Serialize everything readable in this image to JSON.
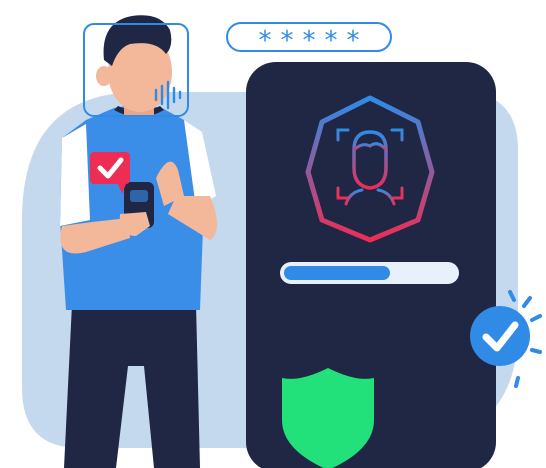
{
  "password_field": {
    "mask": "*****"
  },
  "verification": {
    "progress": 0.62
  },
  "icons": {
    "face_scan": "face-scan-icon",
    "voice_wave": "voice-waveform-icon",
    "checkbox": "checkbox-checked-icon",
    "verified": "verified-check-icon",
    "shield": "security-shield-icon"
  },
  "colors": {
    "background_blob": "#c4d8ee",
    "device": "#1f2744",
    "accent_blue": "#2f8be6",
    "shirt": "#3b8ee8",
    "pants": "#1f2744",
    "skin": "#f3b79a",
    "hair": "#1f2744",
    "checkbox_red": "#ee2d55",
    "shield_green": "#22e07a",
    "gradient_top": "#2f8be6",
    "gradient_bottom": "#ee2d55"
  }
}
